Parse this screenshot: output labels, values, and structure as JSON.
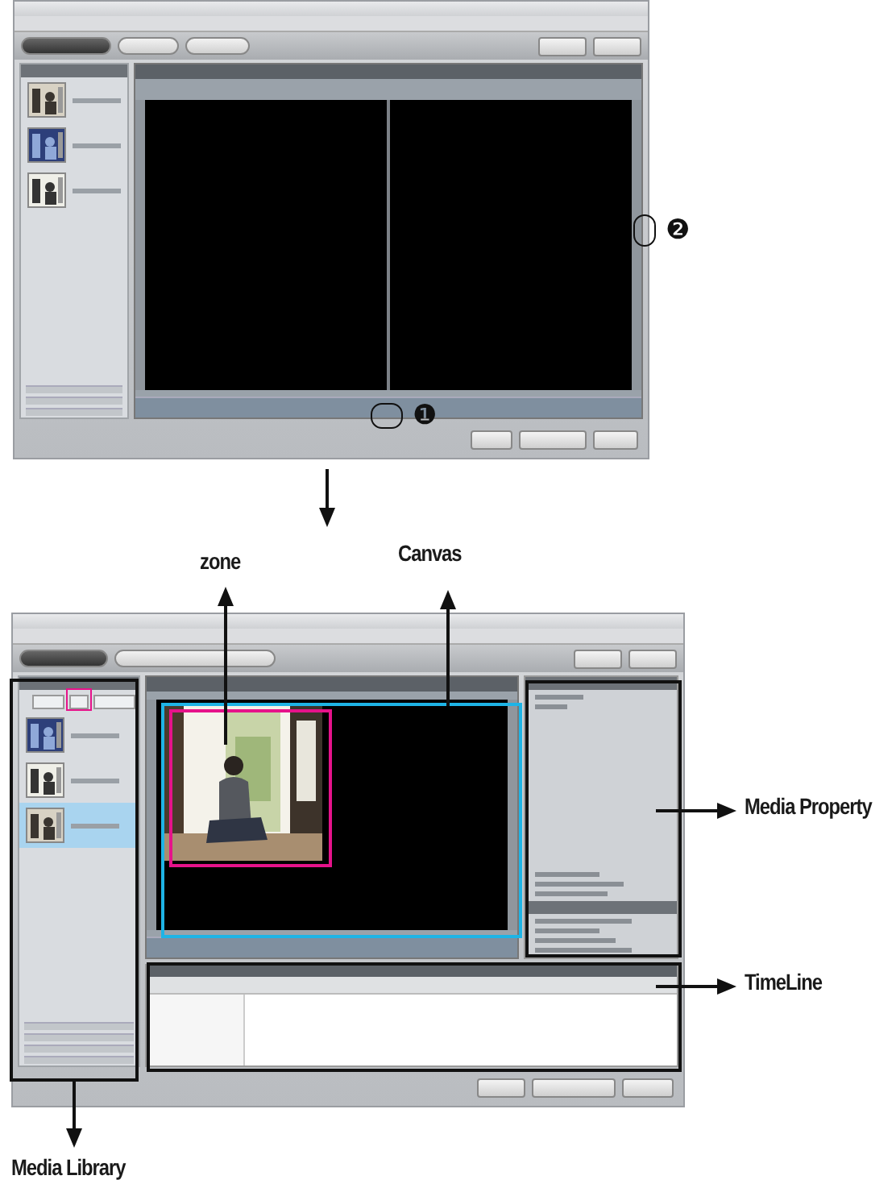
{
  "callouts": [
    {
      "label": "❶"
    },
    {
      "label": "❷"
    }
  ],
  "annotations": [
    {
      "kind": "up",
      "label": "zone"
    },
    {
      "kind": "up",
      "label": "Canvas"
    },
    {
      "kind": "right",
      "label": "Media Property"
    },
    {
      "kind": "right",
      "label": "TimeLine"
    },
    {
      "kind": "down",
      "label": "Media Library"
    }
  ],
  "media_library": {
    "items": [
      {
        "selected": false
      },
      {
        "selected": false
      },
      {
        "selected": true
      }
    ]
  }
}
